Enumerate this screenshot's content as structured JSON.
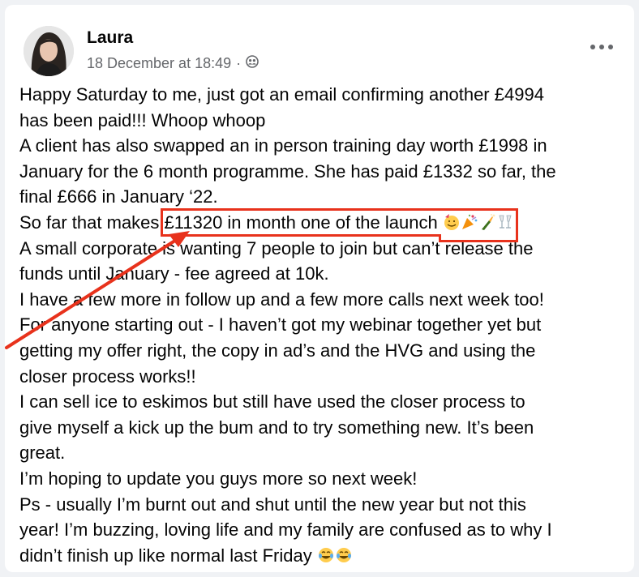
{
  "post": {
    "author": "Laura",
    "timestamp": "18 December at 18:49",
    "separator": "·",
    "audience_icon": "friends-icon",
    "lines": [
      "Happy Saturday to me, just got an email confirming another £4994",
      "has been paid!!! Whoop whoop",
      "A client has also swapped an in person training day worth £1998 in",
      "January for the 6 month programme. She has paid £1332 so far, the",
      "final £666 in January ‘22."
    ],
    "highlight_prefix": "So far that makes ",
    "highlight_text": "£11320 in month one of the launch",
    "lines_after": [
      "A small corporate is wanting 7 people to join but can’t release the",
      "funds until January - fee agreed at 10k.",
      "I have a few more in follow up and a few more calls next week too!",
      "For anyone starting out - I haven’t got my webinar together yet but",
      "getting my offer right, the copy in ad’s and the HVG and using the",
      "closer process works!!",
      "I can sell ice to eskimos but still have used the closer process to",
      "give myself a kick up the bum and to try something new. It’s been",
      "great.",
      "I’m hoping to update you guys more so next week!",
      "Ps - usually I’m burnt out and shut until the new year but not this",
      "year! I’m buzzing, loving life and my family are confused as to why I"
    ],
    "last_line": "didn’t finish up like normal last Friday",
    "highlight_emojis": [
      "partying-face",
      "party-popper",
      "champagne-bottle",
      "clinking-glasses"
    ],
    "last_line_emojis": [
      "tears-of-joy",
      "tears-of-joy"
    ]
  },
  "colors": {
    "annotation_red": "#e8321c",
    "text": "#050505",
    "meta": "#65676b"
  }
}
